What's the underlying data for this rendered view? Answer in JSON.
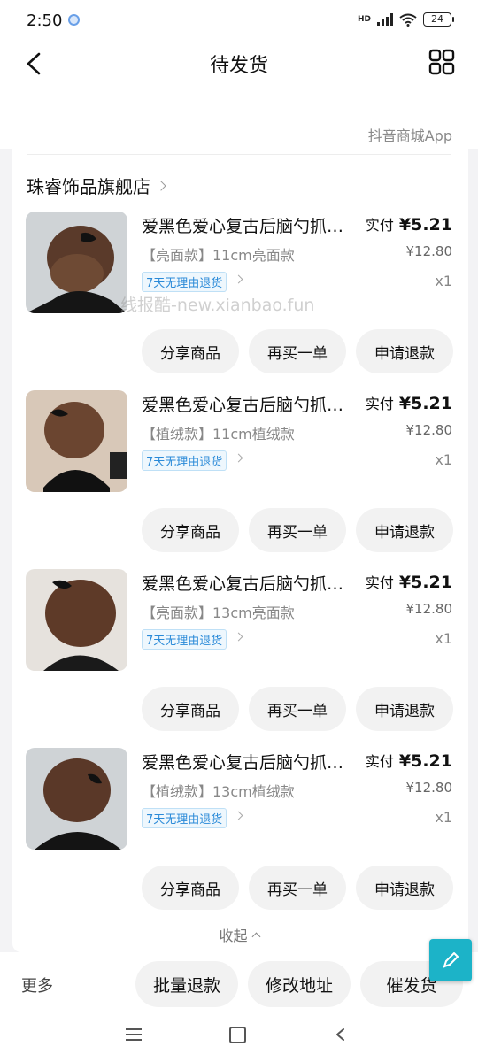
{
  "status_bar": {
    "time": "2:50",
    "battery": "24",
    "hd_label": "HD"
  },
  "header": {
    "title": "待发货"
  },
  "order": {
    "source": "抖音商城App",
    "shop_name": "珠睿饰品旗舰店",
    "items": [
      {
        "name": "爱黑色爱心复古后脑勺抓夹发夹",
        "spec": "【亮面款】11cm亮面款",
        "tag": "7天无理由退货",
        "paid_label": "实付",
        "paid_price": "¥5.21",
        "orig_price": "¥12.80",
        "qty": "x1"
      },
      {
        "name": "爱黑色爱心复古后脑勺抓夹发夹",
        "spec": "【植绒款】11cm植绒款",
        "tag": "7天无理由退货",
        "paid_label": "实付",
        "paid_price": "¥5.21",
        "orig_price": "¥12.80",
        "qty": "x1"
      },
      {
        "name": "爱黑色爱心复古后脑勺抓夹发夹",
        "spec": "【亮面款】13cm亮面款",
        "tag": "7天无理由退货",
        "paid_label": "实付",
        "paid_price": "¥5.21",
        "orig_price": "¥12.80",
        "qty": "x1"
      },
      {
        "name": "爱黑色爱心复古后脑勺抓夹发夹",
        "spec": "【植绒款】13cm植绒款",
        "tag": "7天无理由退货",
        "paid_label": "实付",
        "paid_price": "¥5.21",
        "orig_price": "¥12.80",
        "qty": "x1"
      }
    ],
    "item_actions": {
      "share": "分享商品",
      "rebuy": "再买一单",
      "refund": "申请退款"
    },
    "collapse_label": "收起"
  },
  "watermark": "线报酷-new.xianbao.fun",
  "bottom_bar": {
    "more": "更多",
    "batch_refund": "批量退款",
    "edit_address": "修改地址",
    "urge": "催发货"
  },
  "colors": {
    "accent_tag": "#2a8ad8",
    "fab": "#1cb3c8"
  },
  "icons": [
    "back-icon",
    "grid-icon",
    "edit-pen-icon",
    "menu-icon",
    "home-icon",
    "nav-back-icon"
  ]
}
